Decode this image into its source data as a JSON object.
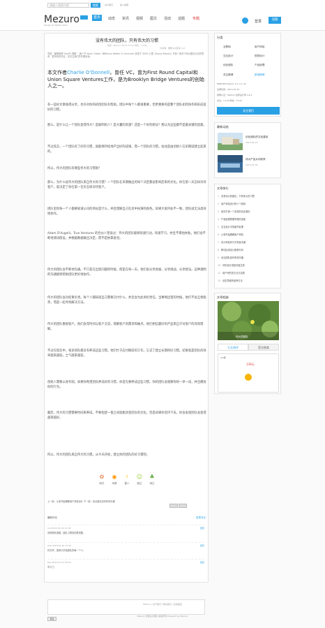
{
  "header": {
    "logo": "Mezuro",
    "badge": "beta",
    "tagline": "Design for Better Work",
    "search_placeholder": "请输入搜索内容",
    "search_button": "搜索",
    "top_links": [
      "设为首页",
      "加入收藏"
    ],
    "nav": [
      {
        "label": "首页",
        "active": true
      },
      {
        "label": "动态"
      },
      {
        "label": "资讯"
      },
      {
        "label": "视频"
      },
      {
        "label": "图文"
      },
      {
        "label": "活动"
      },
      {
        "label": "话题"
      },
      {
        "label": "专题",
        "hot": true
      }
    ],
    "login": "登录",
    "register": "注册"
  },
  "article": {
    "title": "没有伟大的团队，只有伟大的习惯",
    "meta": "来源：Mezuro  2013-01-10  浏览：1,254",
    "share": "分享到：微博 QQ空间 人人",
    "lede": "导语：编辑推荐“SaaSS 课程”（第十节 Kevin Gibbs）和Nelson Walker & Comment 首发于 3000 公里《Vanya Mandy》写的一篇关于伟大团队文化的思考。更多精彩内容，请关注我们的专题阅读。",
    "lead": {
      "before": "本文作者",
      "name": "Charlie O'Donnell",
      "mid": "，曾任 VC，曾为First Round Capital和Union Square Ventures工作，是为Brooklyn Bridge Ventures的创始人之一。"
    },
    "paragraphs": [
      "有一些好文章值得分享，也许对你的初创团队有帮助。团队中每个人都很重要，但更重要的是整个团队如何协作和形成良好的习惯。",
      "那么，是什么让一个团队变得伟大？是聪明的人？是大量的资源？还是一个好的想法？我认为这些都不是最关键的因素。",
      "不过其实，一个团队有了好的习惯，就能够持续地产出好的成果。而一个团队的习惯，往往是由创始人在早期就建立起来的。",
      "所以，伟大的团队有哪些伟大的习惯呢？",
      "那么，为什么说伟大的团队来自伟大的习惯？一个团队在早期做出的每个决定都会影响后来的文化。你在第一天怎样对待客户，就决定了你在第一百天怎样对待客户。",
      "团队里的每一个人都要知道公司的目标是什么，并且理解自己在其中扮演的角色。如果大家目标不一致，团队就无法高效地协作。",
      "Adam D'Augelli，True Ventures 的合伙人曾说过：伟大的团队能够快速行动，快速学习，并且不惧怕失败。他们会不断地测试假设，并根据数据做出决定，而不是依靠直觉。",
      "伟大的团队会不断地沟通。不只是在出现问题的时候，而是在每一天。他们会分享进展，分享挑战，分享想法。这种透明的沟通能够帮助团队更好地协作。",
      "伟大的团队会对结果负责。每个人都知道自己需要交付什么，并且会为此承担责任。当事情出错的时候，他们不会互相指责，而是一起寻找解决方法。",
      "伟大的团队重视客户。他们会花时间与客户交流，理解客户的需求和痛点。他们相信最好的产品来自于对客户的深刻理解。",
      "不过在现实中，很多团队都没有养成这些习惯。他们忙于应付眼前的工作，忘记了建立长期的好习惯。结果就是团队的效率越来越低，士气越来越差。",
      "创始人需要以身作则。如果你希望团队养成好的习惯，你首先要养成这些习惯。你的团队会观察你的一举一动，并且模仿你的行为。",
      "最后，伟大的习惯需要时间来养成。不要指望一夜之间就能改变团队的文化。但是如果你坚持下去，你会发现团队会变得越来越好。",
      "所以，伟大的团队来自伟大的习惯。从今天开始，建立你的团队的好习惯吧。"
    ],
    "reactions": [
      {
        "label": "鲜花",
        "emoji": "✿",
        "color": "#e85"
      },
      {
        "label": "鸡蛋",
        "emoji": "◉",
        "color": "#f90"
      },
      {
        "label": "雷人",
        "emoji": "⚡",
        "color": "#fc3"
      },
      {
        "label": "路过",
        "emoji": "☺",
        "color": "#9c3"
      },
      {
        "label": "难过",
        "emoji": "♣",
        "color": "#6a4"
      }
    ],
    "tags": "上一篇：从零开始理解用户体验设计  下一篇：创业团队如何有效沟通",
    "comments": {
      "title": "最新评论",
      "post_link": "发表评论",
      "items": [
        {
          "user": "luol  2013-01-10 11:02",
          "reply": "回复",
          "body": "说得很有道理，团队习惯真的很重要。"
        },
        {
          "user": "Arel  2013-01-10 13:45",
          "reply": "回复",
          "body": "好文章，值得分享给团队的每一个人。"
        },
        {
          "user": "Rua  2013-01-11 09:20",
          "reply": "回复",
          "body": "学习了。"
        }
      ],
      "submit": "评论"
    }
  },
  "sidebar": {
    "category": {
      "title": "分类",
      "items": [
        "互联网",
        "用户体验",
        "交互设计",
        "视觉设计",
        "创业团队",
        "产品经理"
      ],
      "follow": "关注微博",
      "weibo": "新浪微博",
      "specs": [
        "MEZURO Mezuro 2.1 3.1. 0s",
        "注册时间：2013-01-10",
        "微博认证：Mezuro 创意设计师 4.4.4",
        "关注：1,120  粉丝：3,512"
      ],
      "fans_button": "关注我们"
    },
    "latest": {
      "title": "最新动态",
      "items": [
        {
          "title": "创业团队的文化建设",
          "sub": "2013-01-10"
        },
        {
          "title": "伟大产品从何而来",
          "sub": "2013-01-09"
        }
      ]
    },
    "ranking": {
      "title": "文章排行",
      "items": [
        "没有伟大的团队，只有伟大的习惯",
        "用户体验设计的十个原则",
        "如何打造一个高效的创业团队",
        "产品经理需要掌握的技能",
        "交互设计中的细节处理",
        "从零开始理解用户体验",
        "设计师如何与开发者沟通",
        "移动应用设计趋势分析",
        "创业团队如何有效沟通",
        "好的设计是如何诞生的",
        "用户研究的方法与实践",
        "创意思维的培养方法"
      ]
    },
    "photo": {
      "title": "文章相册",
      "caption": "伟大的团队"
    },
    "tabs": [
      "七天热评",
      "官方热卖"
    ],
    "qq": {
      "title": "QQ群",
      "price": "139元"
    }
  },
  "footer": {
    "links": "Mezuro  |  关于我们  |  联系我们  |  友情链接",
    "copyright": "Mezuro 创意设计团队 版权所有  Powered by Mezuro"
  }
}
